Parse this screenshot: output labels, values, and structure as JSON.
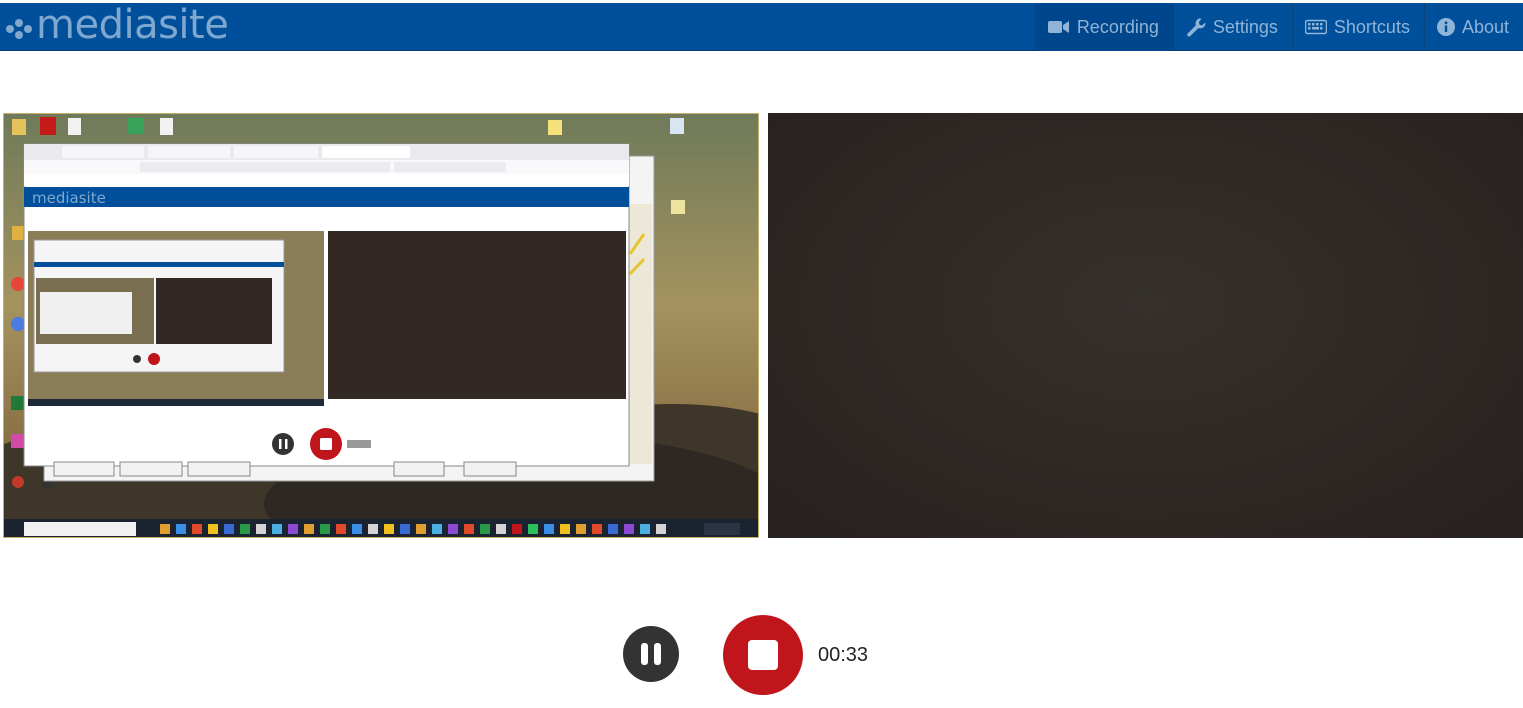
{
  "app": {
    "brand": "mediasite"
  },
  "nav": {
    "items": [
      {
        "label": "Recording",
        "icon": "video-camera-icon",
        "active": true
      },
      {
        "label": "Settings",
        "icon": "wrench-icon",
        "active": false
      },
      {
        "label": "Shortcuts",
        "icon": "keyboard-icon",
        "active": false
      },
      {
        "label": "About",
        "icon": "info-circle-icon",
        "active": false
      }
    ]
  },
  "preview": {
    "screen_icon": "screen-capture-preview",
    "camera_icon": "camera-preview"
  },
  "controls": {
    "pause_icon": "pause-icon",
    "stop_icon": "stop-icon",
    "timer": "00:33"
  },
  "colors": {
    "navbar": "#004f9b",
    "nav_text": "#8fb4d8",
    "stop": "#c0151b",
    "pause": "#333333",
    "camera_bg": "#2e2623"
  }
}
